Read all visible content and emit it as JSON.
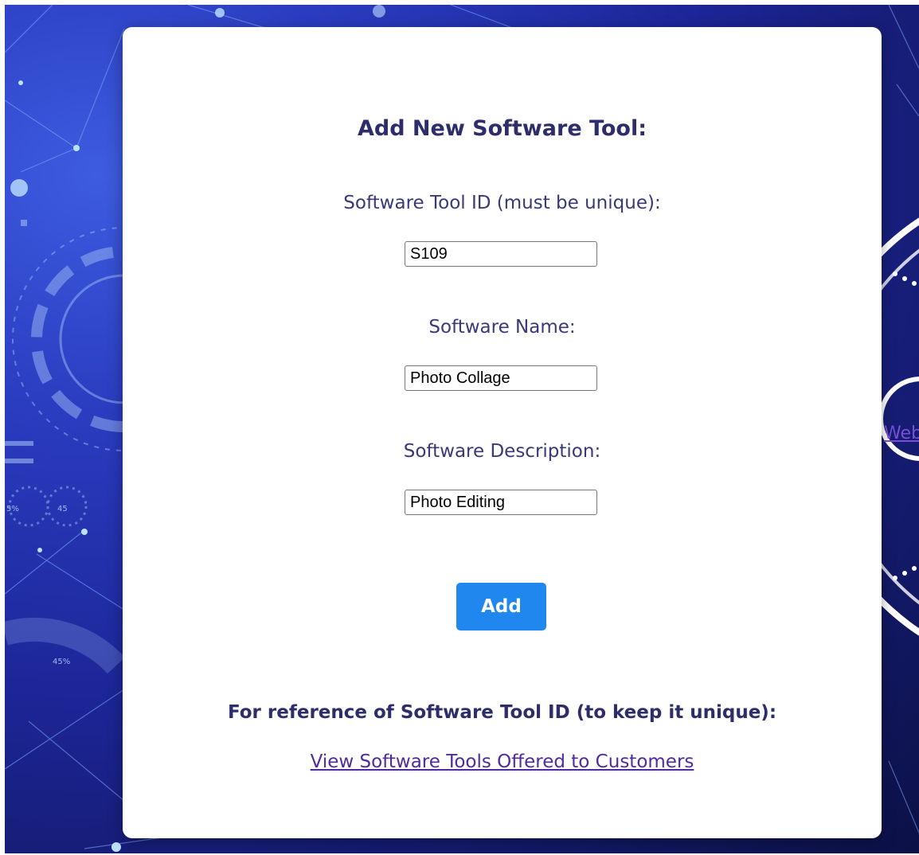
{
  "page": {
    "heading": "Add New Software Tool:",
    "edge_link_fragment": "Web"
  },
  "form": {
    "tool_id": {
      "label": "Software Tool ID (must be unique):",
      "value": "S109"
    },
    "name": {
      "label": "Software Name:",
      "value": "Photo Collage"
    },
    "description": {
      "label": "Software Description:",
      "value": "Photo Editing"
    },
    "submit_label": "Add"
  },
  "reference": {
    "heading": "For reference of Software Tool ID (to keep it unique):",
    "link_text": "View Software Tools Offered to Customers"
  },
  "background_texts": {
    "percent_a": "5%",
    "percent_b": "45",
    "percent_c": "45%"
  },
  "colors": {
    "accent_button": "#1f87ee",
    "heading_text": "#2e2d6b",
    "link": "#4f2aa0",
    "background_deep": "#11175e",
    "background_light": "#3d5ce0"
  }
}
